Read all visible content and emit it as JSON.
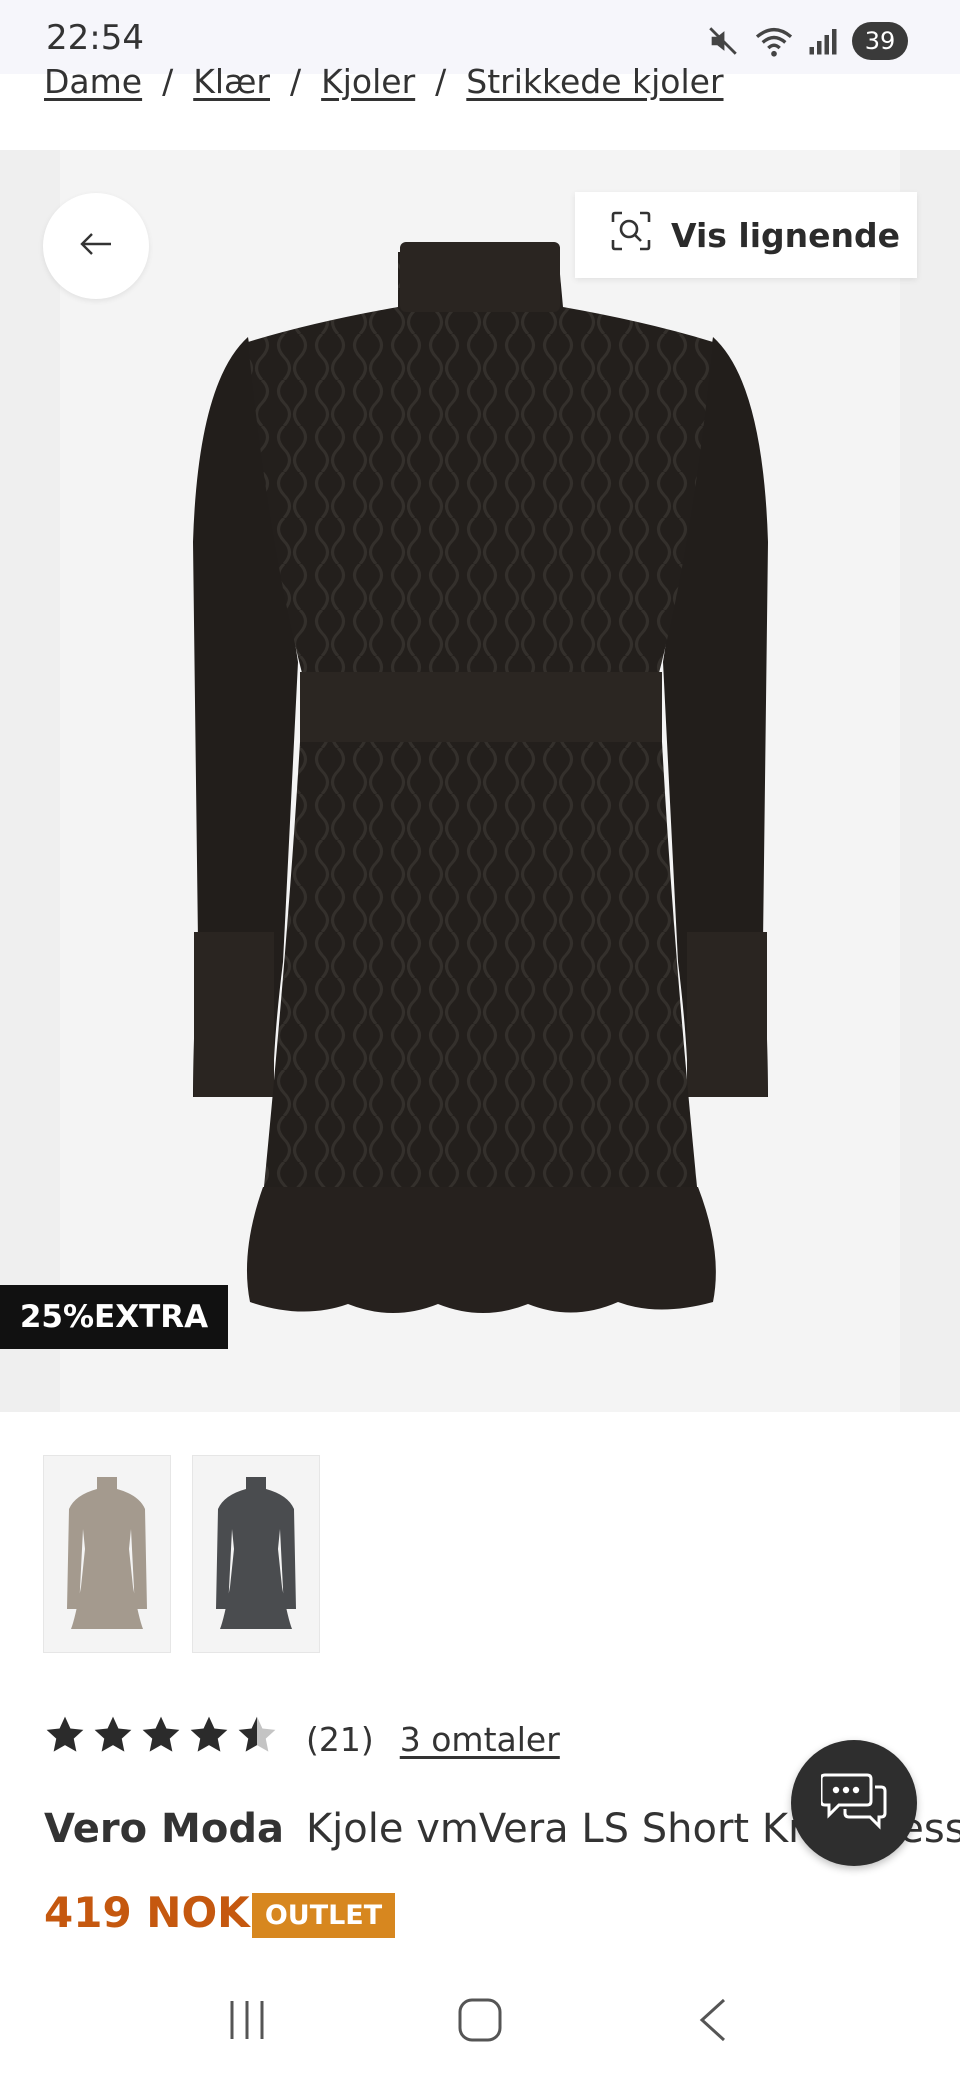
{
  "status_bar": {
    "time": "22:54",
    "battery": "39",
    "icons": [
      "mute-icon",
      "wifi-icon",
      "signal-icon"
    ]
  },
  "breadcrumb": {
    "items": [
      "Dame",
      "Klær",
      "Kjoler",
      "Strikkede kjoler"
    ],
    "separator": "/"
  },
  "image": {
    "similar_label": "Vis lignende",
    "badge": "25%EXTRA"
  },
  "swatches": [
    {
      "name": "beige",
      "color": "#a49a8e"
    },
    {
      "name": "dark-grey",
      "color": "#4a4c4f"
    }
  ],
  "rating": {
    "value": 4.5,
    "max": 5,
    "count": "(21)",
    "reviews_link": "3 omtaler"
  },
  "product": {
    "brand": "Vero Moda",
    "name": "Kjole vmVera LS Short Knit Dress",
    "price": "419 NOK",
    "tag": "OUTLET"
  },
  "colors": {
    "price": "#c5580f",
    "outlet_badge": "#d7871f",
    "dress": "#231f1c"
  }
}
